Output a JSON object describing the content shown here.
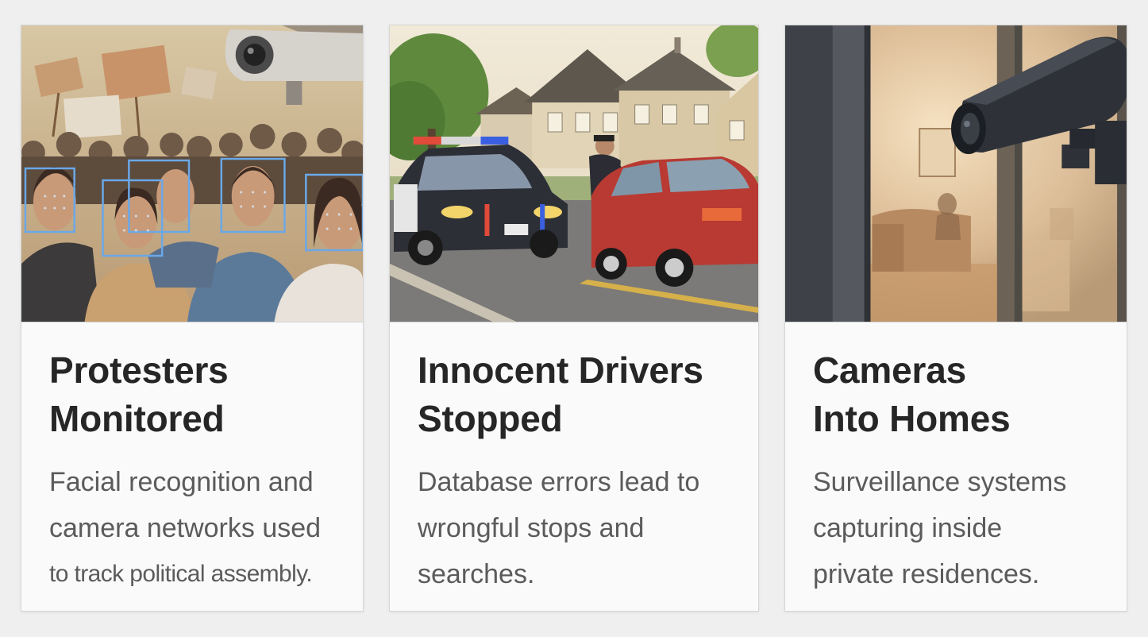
{
  "cards": [
    {
      "title_line1": "Protesters",
      "title_line2": "Monitored",
      "desc_lines": [
        "Facial recognition and",
        "camera networks used",
        "to track political assembly."
      ],
      "image_icon": "protest-crowd-facial-recognition-illustration"
    },
    {
      "title_line1": "Innocent Drivers",
      "title_line2": "Stopped",
      "desc_lines": [
        "Database errors lead to",
        "wrongful stops and",
        "searches."
      ],
      "image_icon": "police-traffic-stop-illustration"
    },
    {
      "title_line1": "Cameras",
      "title_line2": "Into Homes",
      "desc_lines": [
        "Surveillance systems",
        "capturing inside",
        "private residences."
      ],
      "image_icon": "home-surveillance-camera-illustration"
    }
  ],
  "colors": {
    "page_background": "#efefef",
    "card_background": "#fafafa",
    "title": "#262626",
    "description": "#5b5b5b",
    "face_box": "#6aa8e8"
  }
}
